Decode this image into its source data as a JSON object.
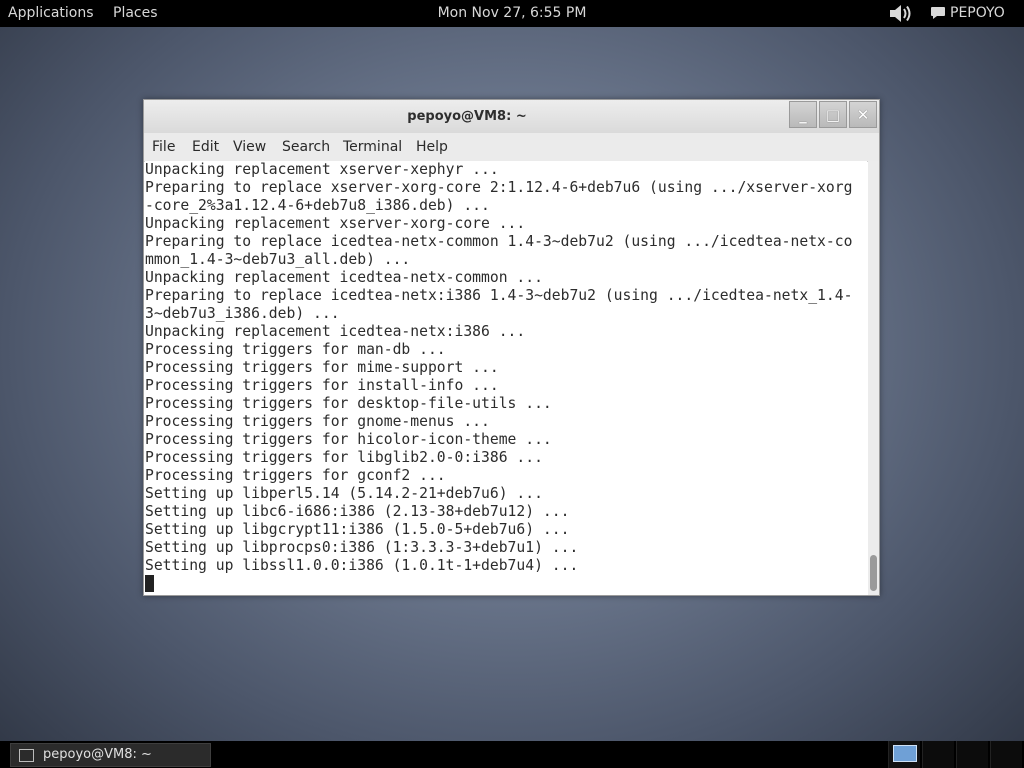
{
  "top_panel": {
    "applications": "Applications",
    "places": "Places",
    "clock": "Mon Nov 27,  6:55 PM",
    "user": "PEPOYO"
  },
  "window": {
    "title": "pepoyo@VM8: ~",
    "buttons": {
      "minimize": "_",
      "maximize": "□",
      "close": "✕"
    },
    "menu": [
      "File",
      "Edit",
      "View",
      "Search",
      "Terminal",
      "Help"
    ]
  },
  "terminal": {
    "lines": [
      "Unpacking replacement xserver-xephyr ...",
      "Preparing to replace xserver-xorg-core 2:1.12.4-6+deb7u6 (using .../xserver-xorg",
      "-core_2%3a1.12.4-6+deb7u8_i386.deb) ...",
      "Unpacking replacement xserver-xorg-core ...",
      "Preparing to replace icedtea-netx-common 1.4-3~deb7u2 (using .../icedtea-netx-co",
      "mmon_1.4-3~deb7u3_all.deb) ...",
      "Unpacking replacement icedtea-netx-common ...",
      "Preparing to replace icedtea-netx:i386 1.4-3~deb7u2 (using .../icedtea-netx_1.4-",
      "3~deb7u3_i386.deb) ...",
      "Unpacking replacement icedtea-netx:i386 ...",
      "Processing triggers for man-db ...",
      "Processing triggers for mime-support ...",
      "Processing triggers for install-info ...",
      "Processing triggers for desktop-file-utils ...",
      "Processing triggers for gnome-menus ...",
      "Processing triggers for hicolor-icon-theme ...",
      "Processing triggers for libglib2.0-0:i386 ...",
      "Processing triggers for gconf2 ...",
      "Setting up libperl5.14 (5.14.2-21+deb7u6) ...",
      "Setting up libc6-i686:i386 (2.13-38+deb7u12) ...",
      "Setting up libgcrypt11:i386 (1.5.0-5+deb7u6) ...",
      "Setting up libprocps0:i386 (1:3.3.3-3+deb7u1) ...",
      "Setting up libssl1.0.0:i386 (1.0.1t-1+deb7u4) ..."
    ]
  },
  "taskbar": {
    "task_label": "pepoyo@VM8: ~"
  }
}
